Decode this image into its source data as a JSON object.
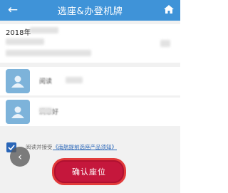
{
  "header": {
    "title": "选座&办登机牌",
    "back_icon": "arrow-left-icon",
    "home_icon": "home-icon",
    "background_color": "#3f93d8"
  },
  "flight_info": {
    "date_text": "2018年"
  },
  "passengers": [
    {
      "name": "阅读"
    },
    {
      "name": "满意好"
    }
  ],
  "agreement": {
    "checked": true,
    "label": "阅读并接受",
    "link_text": "《南航提前选座产品须知》"
  },
  "confirm_button": {
    "label": "确认座位",
    "color": "#c5173c"
  }
}
